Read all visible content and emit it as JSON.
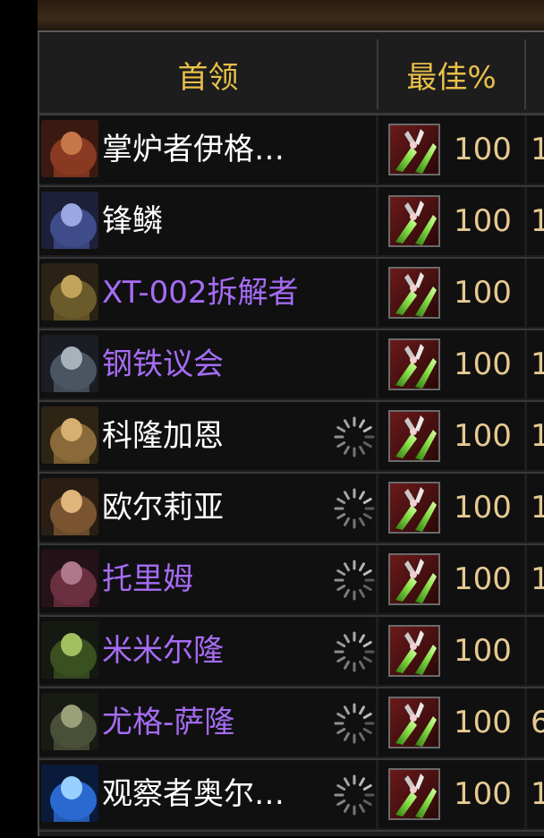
{
  "header": {
    "boss_label": "首领",
    "best_label": "最佳%"
  },
  "colors": {
    "header_gold": "#e8bf4a",
    "name_white": "#ffffff",
    "name_purple": "#a66cf5",
    "pct_tan": "#e6ca93"
  },
  "rows": [
    {
      "name": "掌炉者伊格…",
      "color": "#ffffff",
      "best": "100",
      "spinner": false,
      "next_peek": "1",
      "portrait_icon": "ignis-portrait-icon"
    },
    {
      "name": "锋鳞",
      "color": "#ffffff",
      "best": "100",
      "spinner": false,
      "next_peek": "1",
      "portrait_icon": "razorscale-portrait-icon"
    },
    {
      "name": "XT-002拆解者",
      "color": "#a66cf5",
      "best": "100",
      "spinner": false,
      "next_peek": "",
      "portrait_icon": "xt002-portrait-icon"
    },
    {
      "name": "钢铁议会",
      "color": "#a66cf5",
      "best": "100",
      "spinner": false,
      "next_peek": "1",
      "portrait_icon": "iron-council-portrait-icon"
    },
    {
      "name": "科隆加恩",
      "color": "#ffffff",
      "best": "100",
      "spinner": true,
      "next_peek": "1",
      "portrait_icon": "kologarn-portrait-icon"
    },
    {
      "name": "欧尔莉亚",
      "color": "#ffffff",
      "best": "100",
      "spinner": true,
      "next_peek": "1",
      "portrait_icon": "auriaya-portrait-icon"
    },
    {
      "name": "托里姆",
      "color": "#a66cf5",
      "best": "100",
      "spinner": true,
      "next_peek": "1",
      "portrait_icon": "thorim-portrait-icon"
    },
    {
      "name": "米米尔隆",
      "color": "#a66cf5",
      "best": "100",
      "spinner": true,
      "next_peek": "",
      "portrait_icon": "mimiron-portrait-icon"
    },
    {
      "name": "尤格-萨隆",
      "color": "#a66cf5",
      "best": "100",
      "spinner": true,
      "next_peek": "6",
      "portrait_icon": "yogg-saron-portrait-icon"
    },
    {
      "name": "观察者奥尔…",
      "color": "#ffffff",
      "best": "100",
      "spinner": true,
      "next_peek": "1",
      "portrait_icon": "algalon-portrait-icon"
    }
  ]
}
